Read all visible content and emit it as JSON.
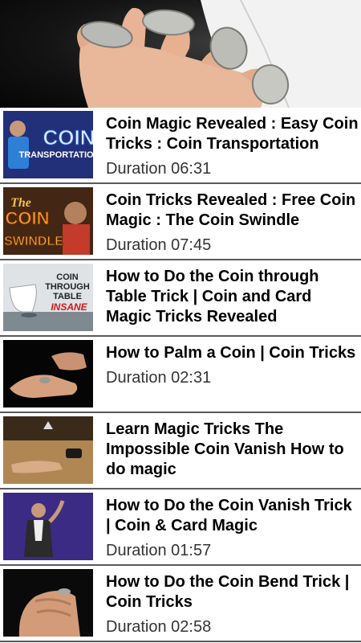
{
  "header": {
    "image": "coin-magic-hand-banner"
  },
  "videos": [
    {
      "title": "Coin Magic Revealed : Easy Coin Tricks : Coin Transportation",
      "duration": "Duration 06:31",
      "thumb_text": [
        "COIN",
        "TRANSPORTATION"
      ]
    },
    {
      "title": "Coin Tricks Revealed : Free Coin Magic : The Coin Swindle",
      "duration": "Duration 07:45",
      "thumb_text": [
        "The",
        "COIN",
        "SWINDLE"
      ]
    },
    {
      "title": "How to Do the Coin through Table Trick | Coin and Card Magic Tricks Revealed",
      "duration": "",
      "thumb_text": [
        "COIN",
        "THROUGH",
        "TABLE",
        "INSANE"
      ]
    },
    {
      "title": "How to Palm a Coin | Coin Tricks",
      "duration": "Duration 02:31",
      "thumb_text": []
    },
    {
      "title": "Learn Magic Tricks The Impossible Coin Vanish How to do magic",
      "duration": "",
      "thumb_text": []
    },
    {
      "title": "How to Do the Coin Vanish Trick | Coin & Card Magic",
      "duration": "Duration 01:57",
      "thumb_text": []
    },
    {
      "title": "How to Do the Coin Bend Trick | Coin Tricks",
      "duration": "Duration 02:58",
      "thumb_text": []
    }
  ],
  "colors": {
    "divider": "#5a5a5a",
    "coin_text_blue": "#1a4fb5",
    "swindle_orange": "#e07a10",
    "insane_red": "#d01818"
  }
}
